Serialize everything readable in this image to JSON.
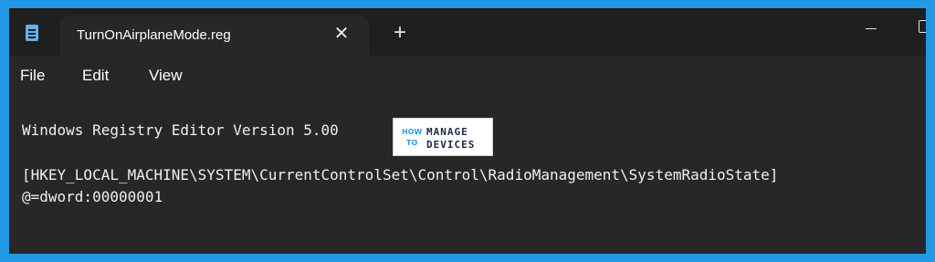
{
  "tab": {
    "title": "TurnOnAirplaneMode.reg",
    "close_symbol": "✕",
    "new_tab_symbol": "+"
  },
  "menu": {
    "file": "File",
    "edit": "Edit",
    "view": "View"
  },
  "editor": {
    "lines": [
      "Windows Registry Editor Version 5.00",
      "",
      "[HKEY_LOCAL_MACHINE\\SYSTEM\\CurrentControlSet\\Control\\RadioManagement\\SystemRadioState]",
      "@=dword:00000001"
    ]
  },
  "logo": {
    "how": "HOW",
    "to": "TO",
    "manage": "MANAGE",
    "devices": "DEVICES"
  },
  "icons": {
    "app": "notepad-icon",
    "close": "close-icon",
    "new_tab": "plus-icon",
    "minimize": "minimize-icon",
    "maximize": "maximize-icon"
  },
  "colors": {
    "background": "#2299e6",
    "titlebar": "#1f1f1f",
    "editor": "#272727",
    "text": "#f0f0f0",
    "app_icon": "#5fb2f0"
  }
}
